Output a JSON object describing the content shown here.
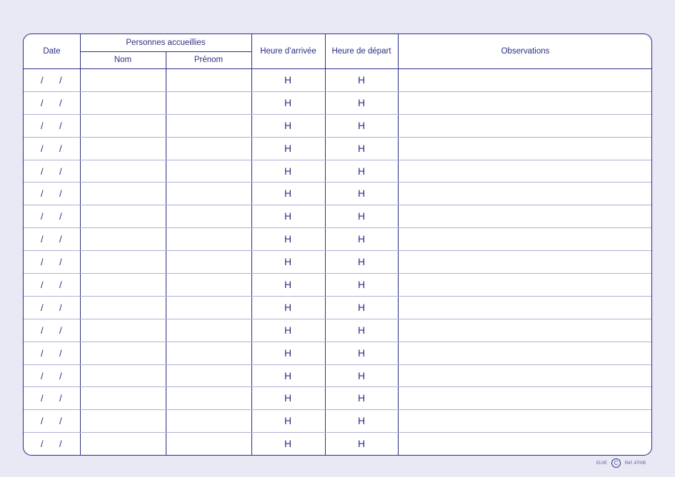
{
  "header": {
    "date": "Date",
    "personnes": "Personnes accueillies",
    "nom": "Nom",
    "prenom": "Prénom",
    "arrivee": "Heure d’arrivée",
    "depart": "Heure de départ",
    "observations": "Observations"
  },
  "row_template": {
    "date_slash": "/",
    "hour_mark": "H"
  },
  "row_count": 17,
  "footer": {
    "brand": "ELVE",
    "logo_glyph": "C",
    "ref": "Réf. 47005"
  }
}
